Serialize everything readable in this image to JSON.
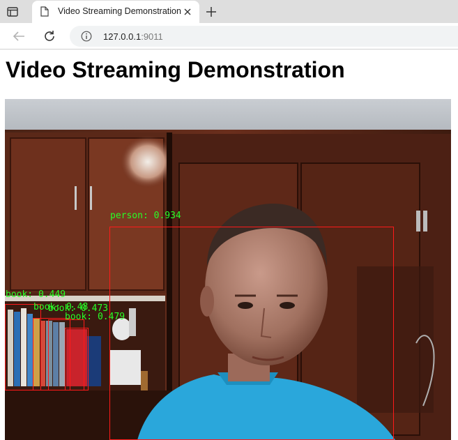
{
  "browser": {
    "tab_title": "Video Streaming Demonstration",
    "url_host": "127.0.0.1",
    "url_port": ":9011"
  },
  "page": {
    "title": "Video Streaming Demonstration"
  },
  "detections": [
    {
      "label": "person: 0.934"
    },
    {
      "label": "book: 0.449"
    },
    {
      "label": "book: 0.473"
    },
    {
      "label": "book: 0.479"
    },
    {
      "label": "book: 0.48"
    }
  ],
  "colors": {
    "box": "#ff1a1a",
    "label": "#27ff27"
  }
}
